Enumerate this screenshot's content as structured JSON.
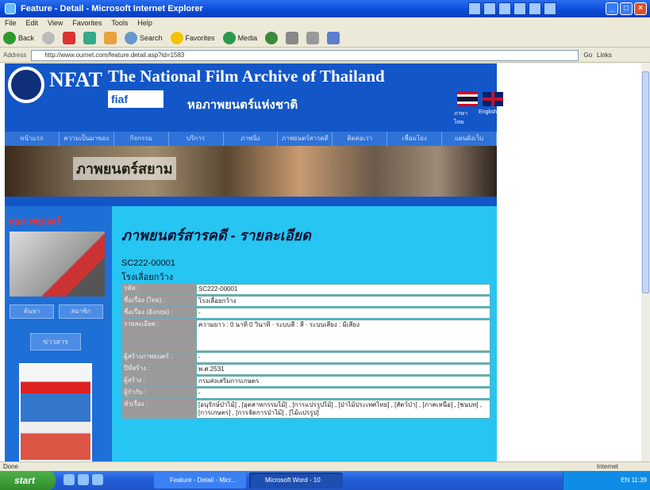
{
  "window": {
    "title": "Feature - Detail - Microsoft Internet Explorer"
  },
  "menu": [
    "File",
    "Edit",
    "View",
    "Favorites",
    "Tools",
    "Help"
  ],
  "toolbar": {
    "back": "Back",
    "search": "Search",
    "favorites": "Favorites",
    "media": "Media"
  },
  "address": {
    "label": "Address",
    "url": "http://www.ournet.com/feature.detail.asp?id=1583",
    "go": "Go",
    "links": "Links"
  },
  "site": {
    "title": "The National Film Archive of Thailand",
    "subtitle": "หอภาพยนตร์แห่งชาติ",
    "logo_text": "NFAT",
    "fiaf_text": "fiaf",
    "lang_th": "ภาษาไทย",
    "lang_en": "English",
    "nav": [
      "หน้าแรก",
      "ความเป็นมาของ",
      "กิจกรรม",
      "บริการ",
      "ภาพนิ่ง",
      "ภาพยนตร์สารคดี",
      "ติดต่อเรา",
      "เชื่อมโยง",
      "แผนผังเว็บ"
    ],
    "banner_text": "ภาพยนตร์สยาม"
  },
  "left": {
    "heading": "หอภาพยนตร์",
    "btn1": "ค้นหา",
    "btn2": "สมาชิก",
    "link": "ข่าวสาร"
  },
  "content": {
    "title": "ภาพยนตร์สารคดี - รายละเอียด",
    "code": "SC222-00001",
    "name": "โรงเลื่อยกว้าง",
    "rows": [
      {
        "label": "รหัส :",
        "value": "SC222-00001"
      },
      {
        "label": "ชื่อเรื่อง (ไทย) :",
        "value": "โรงเลื่อยกว้าง"
      },
      {
        "label": "ชื่อเรื่อง (อังกฤษ) :",
        "value": "-"
      },
      {
        "label": "รายละเอียด :",
        "value": "ความยาว : 0 นาที 0 วินาที · ระบบสี : สี · ระบบเสียง : มีเสียง"
      },
      {
        "label": "ผู้สร้างภาพยนตร์ :",
        "value": "-"
      },
      {
        "label": "ปีที่สร้าง :",
        "value": "พ.ศ.2531"
      },
      {
        "label": "ผู้สร้าง :",
        "value": "กรมส่งเสริมการเกษตร"
      },
      {
        "label": "ผู้กำกับ :",
        "value": "-"
      },
      {
        "label": "หัวเรื่อง :",
        "value": "[อนุรักษ์ป่าไม้] , [อุตสาหกรรมไม้] , [การแปรรูปไม้] , [ป่าไม้ประเทศไทย] , [สัตว์ป่า] , [ภาคเหนือ] , [ชนบท] , [การเกษตร] , [การจัดการป่าไม้] , [ไม้แปรรูป]"
      }
    ]
  },
  "status": {
    "text": "Done",
    "zone": "Internet"
  },
  "taskbar": {
    "start": "start",
    "task1": "Feature - Detail - Micr...",
    "task2": "Microsoft Word - 10",
    "clock": "EN 11:39"
  }
}
